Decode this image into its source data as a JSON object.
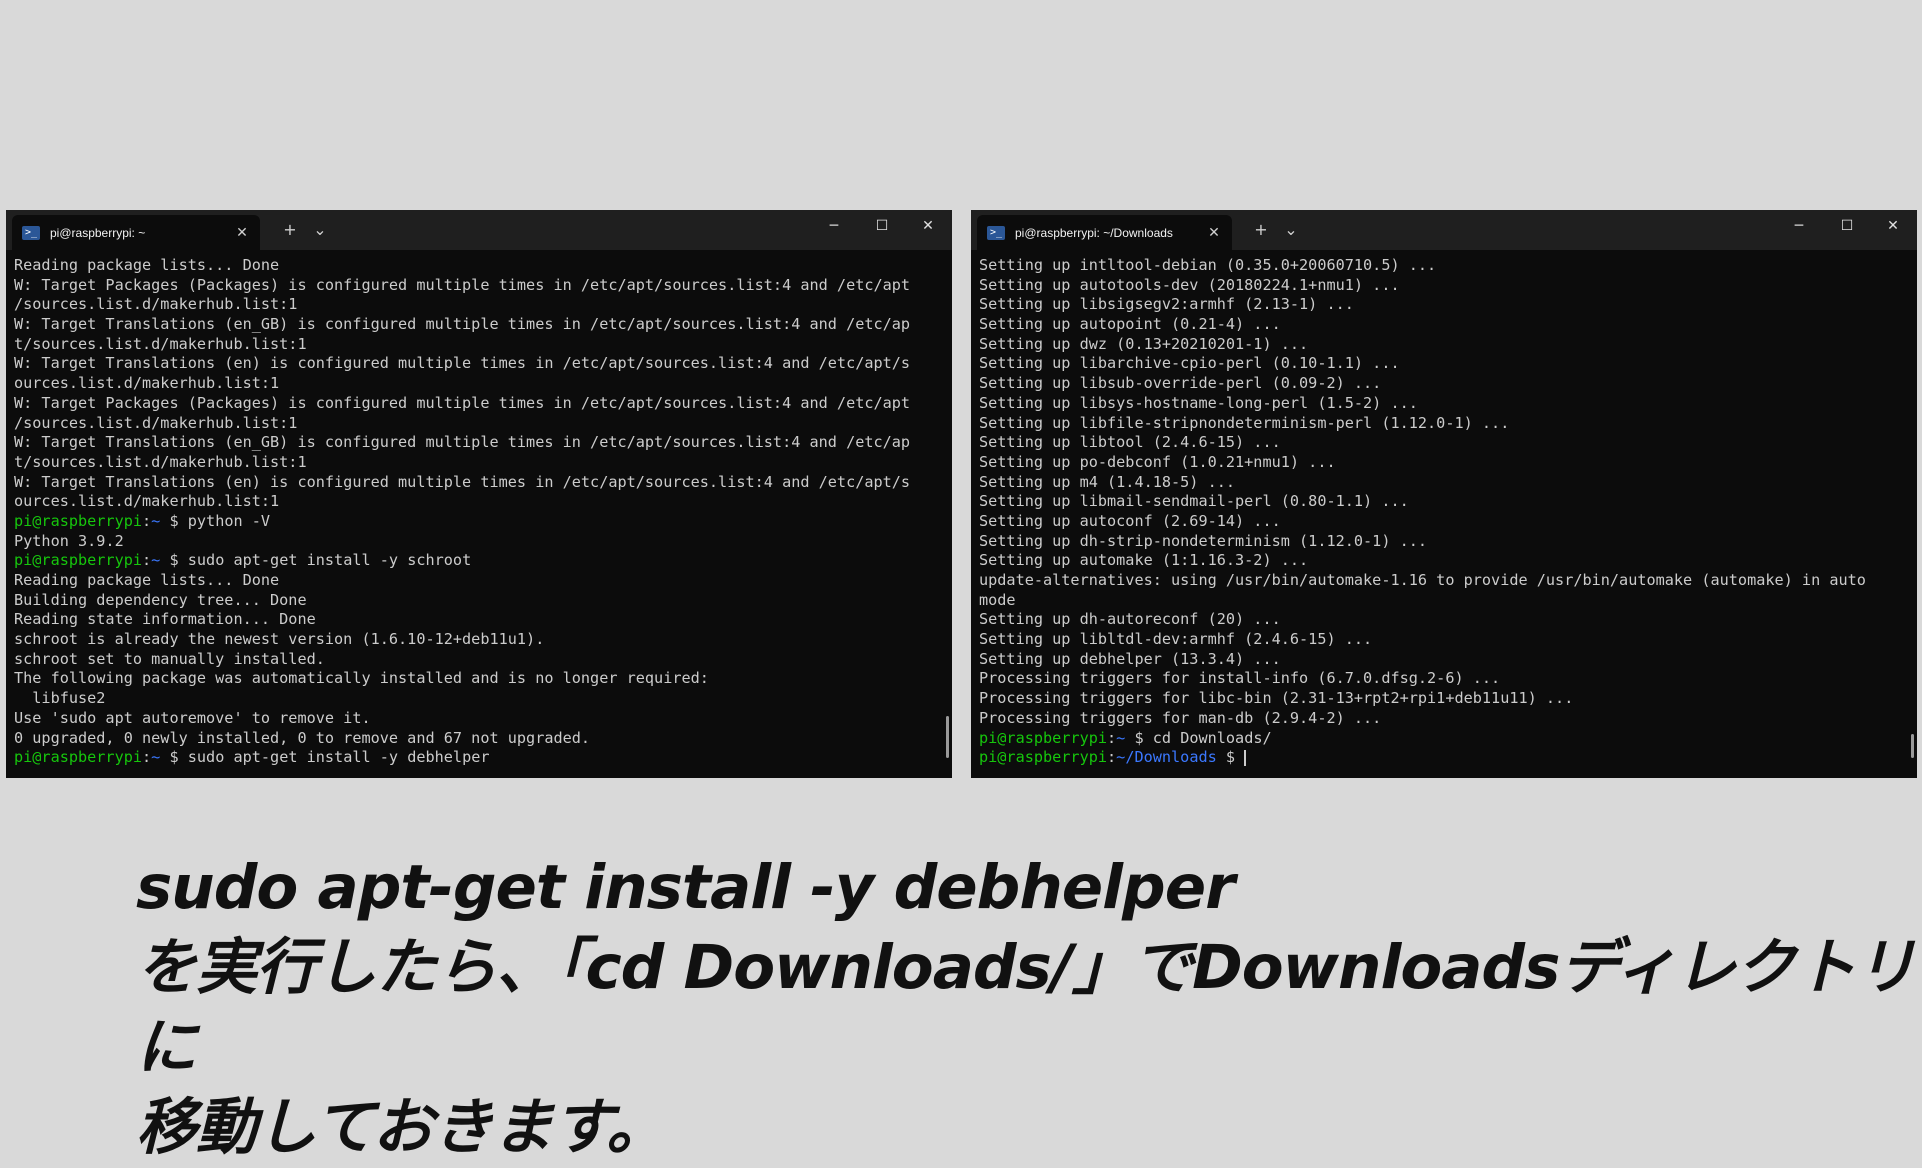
{
  "left_terminal": {
    "tab_title": "pi@raspberrypi: ~",
    "lines": [
      [
        {
          "t": "Reading package lists... Done",
          "c": "w"
        }
      ],
      [
        {
          "t": "W: Target Packages (Packages) is configured multiple times in /etc/apt/sources.list:4 and /etc/apt",
          "c": "w"
        }
      ],
      [
        {
          "t": "/sources.list.d/makerhub.list:1",
          "c": "w"
        }
      ],
      [
        {
          "t": "W: Target Translations (en_GB) is configured multiple times in /etc/apt/sources.list:4 and /etc/ap",
          "c": "w"
        }
      ],
      [
        {
          "t": "t/sources.list.d/makerhub.list:1",
          "c": "w"
        }
      ],
      [
        {
          "t": "W: Target Translations (en) is configured multiple times in /etc/apt/sources.list:4 and /etc/apt/s",
          "c": "w"
        }
      ],
      [
        {
          "t": "ources.list.d/makerhub.list:1",
          "c": "w"
        }
      ],
      [
        {
          "t": "W: Target Packages (Packages) is configured multiple times in /etc/apt/sources.list:4 and /etc/apt",
          "c": "w"
        }
      ],
      [
        {
          "t": "/sources.list.d/makerhub.list:1",
          "c": "w"
        }
      ],
      [
        {
          "t": "W: Target Translations (en_GB) is configured multiple times in /etc/apt/sources.list:4 and /etc/ap",
          "c": "w"
        }
      ],
      [
        {
          "t": "t/sources.list.d/makerhub.list:1",
          "c": "w"
        }
      ],
      [
        {
          "t": "W: Target Translations (en) is configured multiple times in /etc/apt/sources.list:4 and /etc/apt/s",
          "c": "w"
        }
      ],
      [
        {
          "t": "ources.list.d/makerhub.list:1",
          "c": "w"
        }
      ],
      [
        {
          "t": "pi@raspberrypi",
          "c": "g"
        },
        {
          "t": ":",
          "c": "w"
        },
        {
          "t": "~",
          "c": "b"
        },
        {
          "t": " $ python -V",
          "c": "w"
        }
      ],
      [
        {
          "t": "Python 3.9.2",
          "c": "w"
        }
      ],
      [
        {
          "t": "pi@raspberrypi",
          "c": "g"
        },
        {
          "t": ":",
          "c": "w"
        },
        {
          "t": "~",
          "c": "b"
        },
        {
          "t": " $ sudo apt-get install -y schroot",
          "c": "w"
        }
      ],
      [
        {
          "t": "Reading package lists... Done",
          "c": "w"
        }
      ],
      [
        {
          "t": "Building dependency tree... Done",
          "c": "w"
        }
      ],
      [
        {
          "t": "Reading state information... Done",
          "c": "w"
        }
      ],
      [
        {
          "t": "schroot is already the newest version (1.6.10-12+deb11u1).",
          "c": "w"
        }
      ],
      [
        {
          "t": "schroot set to manually installed.",
          "c": "w"
        }
      ],
      [
        {
          "t": "The following package was automatically installed and is no longer required:",
          "c": "w"
        }
      ],
      [
        {
          "t": "  libfuse2",
          "c": "w"
        }
      ],
      [
        {
          "t": "Use 'sudo apt autoremove' to remove it.",
          "c": "w"
        }
      ],
      [
        {
          "t": "0 upgraded, 0 newly installed, 0 to remove and 67 not upgraded.",
          "c": "w"
        }
      ],
      [
        {
          "t": "pi@raspberrypi",
          "c": "g"
        },
        {
          "t": ":",
          "c": "w"
        },
        {
          "t": "~",
          "c": "b"
        },
        {
          "t": " $ sudo apt-get install -y debhelper",
          "c": "w"
        }
      ]
    ]
  },
  "right_terminal": {
    "tab_title": "pi@raspberrypi: ~/Downloads",
    "lines": [
      [
        {
          "t": "Setting up intltool-debian (0.35.0+20060710.5) ...",
          "c": "w"
        }
      ],
      [
        {
          "t": "Setting up autotools-dev (20180224.1+nmu1) ...",
          "c": "w"
        }
      ],
      [
        {
          "t": "Setting up libsigsegv2:armhf (2.13-1) ...",
          "c": "w"
        }
      ],
      [
        {
          "t": "Setting up autopoint (0.21-4) ...",
          "c": "w"
        }
      ],
      [
        {
          "t": "Setting up dwz (0.13+20210201-1) ...",
          "c": "w"
        }
      ],
      [
        {
          "t": "Setting up libarchive-cpio-perl (0.10-1.1) ...",
          "c": "w"
        }
      ],
      [
        {
          "t": "Setting up libsub-override-perl (0.09-2) ...",
          "c": "w"
        }
      ],
      [
        {
          "t": "Setting up libsys-hostname-long-perl (1.5-2) ...",
          "c": "w"
        }
      ],
      [
        {
          "t": "Setting up libfile-stripnondeterminism-perl (1.12.0-1) ...",
          "c": "w"
        }
      ],
      [
        {
          "t": "Setting up libtool (2.4.6-15) ...",
          "c": "w"
        }
      ],
      [
        {
          "t": "Setting up po-debconf (1.0.21+nmu1) ...",
          "c": "w"
        }
      ],
      [
        {
          "t": "Setting up m4 (1.4.18-5) ...",
          "c": "w"
        }
      ],
      [
        {
          "t": "Setting up libmail-sendmail-perl (0.80-1.1) ...",
          "c": "w"
        }
      ],
      [
        {
          "t": "Setting up autoconf (2.69-14) ...",
          "c": "w"
        }
      ],
      [
        {
          "t": "Setting up dh-strip-nondeterminism (1.12.0-1) ...",
          "c": "w"
        }
      ],
      [
        {
          "t": "Setting up automake (1:1.16.3-2) ...",
          "c": "w"
        }
      ],
      [
        {
          "t": "update-alternatives: using /usr/bin/automake-1.16 to provide /usr/bin/automake (automake) in auto",
          "c": "w"
        }
      ],
      [
        {
          "t": "mode",
          "c": "w"
        }
      ],
      [
        {
          "t": "Setting up dh-autoreconf (20) ...",
          "c": "w"
        }
      ],
      [
        {
          "t": "Setting up libltdl-dev:armhf (2.4.6-15) ...",
          "c": "w"
        }
      ],
      [
        {
          "t": "Setting up debhelper (13.3.4) ...",
          "c": "w"
        }
      ],
      [
        {
          "t": "Processing triggers for install-info (6.7.0.dfsg.2-6) ...",
          "c": "w"
        }
      ],
      [
        {
          "t": "Processing triggers for libc-bin (2.31-13+rpt2+rpi1+deb11u11) ...",
          "c": "w"
        }
      ],
      [
        {
          "t": "Processing triggers for man-db (2.9.4-2) ...",
          "c": "w"
        }
      ],
      [
        {
          "t": "pi@raspberrypi",
          "c": "g"
        },
        {
          "t": ":",
          "c": "w"
        },
        {
          "t": "~",
          "c": "b"
        },
        {
          "t": " $ cd Downloads/",
          "c": "w"
        }
      ],
      [
        {
          "t": "pi@raspberrypi",
          "c": "g"
        },
        {
          "t": ":",
          "c": "w"
        },
        {
          "t": "~/Downloads",
          "c": "b"
        },
        {
          "t": " $ ",
          "c": "w"
        }
      ]
    ]
  },
  "window_controls": {
    "new_tab": "+",
    "dropdown": "⌄",
    "minimize": "─",
    "maximize": "☐",
    "close": "✕",
    "tab_close": "✕"
  },
  "caption": {
    "line1": "sudo apt-get install -y debhelper",
    "line2": "を実行したら、「cd Downloads/」でDownloadsディレクトリに",
    "line3": "移動しておきます。"
  },
  "colors": {
    "prompt_user": "#16c60c",
    "prompt_path": "#3b78ff",
    "text": "#cccccc",
    "terminal_bg": "#0c0c0c"
  }
}
